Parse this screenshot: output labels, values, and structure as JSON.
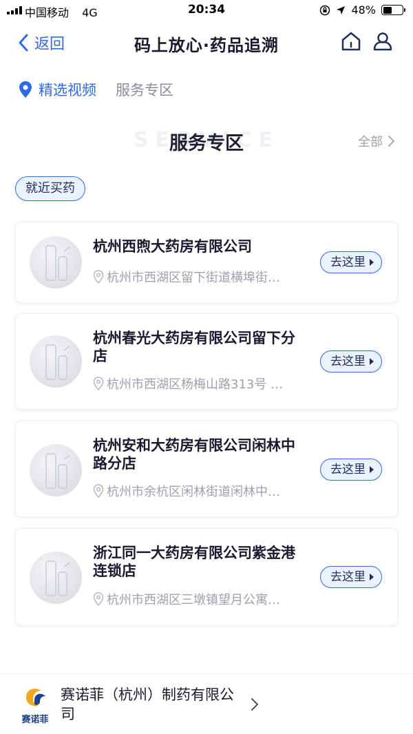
{
  "status_bar": {
    "carrier": "中国移动",
    "network": "4G",
    "time": "20:34",
    "battery": "48%",
    "battery_level": 0.48
  },
  "nav": {
    "back_label": "返回",
    "title": "码上放心·药品追溯",
    "accent_color": "#2e6be6"
  },
  "tabs": [
    {
      "label": "精选视频",
      "active": true
    },
    {
      "label": "服务专区",
      "active": false
    }
  ],
  "section": {
    "bg_text": "SERVICE",
    "title": "服务专区",
    "see_all": "全部"
  },
  "filter_chip": "就近买药",
  "pharmacies": [
    {
      "name": "杭州西煦大药房有限公司",
      "address": "杭州市西湖区留下街道横埠街…",
      "action": "去这里"
    },
    {
      "name": "杭州春光大药房有限公司留下分店",
      "address": "杭州市西湖区杨梅山路313号 …",
      "action": "去这里"
    },
    {
      "name": "杭州安和大药房有限公司闲林中路分店",
      "address": "杭州市余杭区闲林街道闲林中…",
      "action": "去这里"
    },
    {
      "name": "浙江同一大药房有限公司紫金港连锁店",
      "address": "杭州市西湖区三墩镇望月公寓…",
      "action": "去这里"
    }
  ],
  "footer": {
    "logo_text": "赛诺菲",
    "company": "赛诺菲（杭州）制药有限公司"
  }
}
